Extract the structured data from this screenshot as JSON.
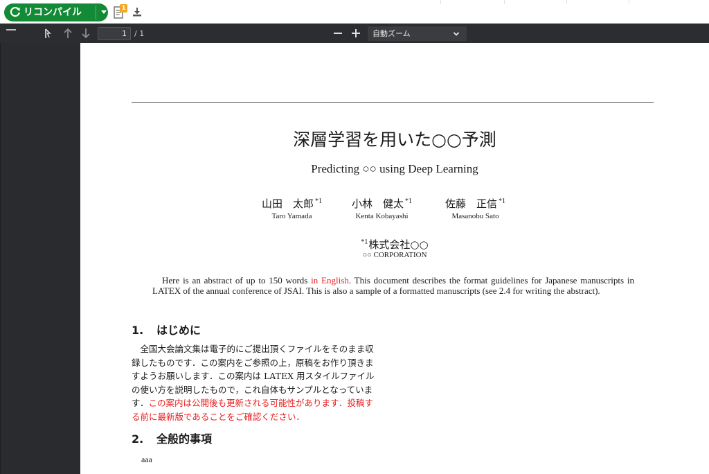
{
  "toolbar": {
    "recompile_label": "リコンパイル",
    "logs_badge_count": "1"
  },
  "pdf_toolbar": {
    "page_current": "1",
    "page_total": "/ 1",
    "zoom_label": "自動ズーム"
  },
  "document": {
    "title_ja": "深層学習を用いた○○予測",
    "title_en": "Predicting ○○ using Deep Learning",
    "authors": [
      {
        "name_ja": "山田　太郎",
        "mark": "*1",
        "name_en": "Taro Yamada"
      },
      {
        "name_ja": "小林　健太",
        "mark": "*1",
        "name_en": "Kenta Kobayashi"
      },
      {
        "name_ja": "佐藤　正信",
        "mark": "*1",
        "name_en": "Masanobu Sato"
      }
    ],
    "affiliation_mark": "*1",
    "affiliation_ja": "株式会社○○",
    "affiliation_en": "○○ CORPORATION",
    "abstract": {
      "part1": "Here is an abstract of up to 150 words ",
      "highlight": "in English",
      "part2": ". This document describes the format guidelines for Japanese manuscripts in LATEX of the annual conference of JSAI. This is also a sample of a formatted manuscripts (see 2.4 for writing the abstract)."
    },
    "sections": [
      {
        "number": "1.",
        "title": "はじめに",
        "lines": [
          "　全国大会論文集は電子的にご提出頂くファイルをそのまま収",
          "録したものです．この案内をご参照の上，原稿をお作り頂きま",
          "すようお願いします．この案内は LATEX 用スタイルファイル",
          "の使い方を説明したもので，これ自体もサンプルとなっていま"
        ],
        "line5_plain": "す．",
        "line5_red": "この案内は公開後も更新される可能性があります．投稿す",
        "line6_red": "る前に最新版であることをご確認ください．"
      },
      {
        "number": "2.",
        "title": "全般的事項",
        "text": "aaa"
      }
    ]
  },
  "colors": {
    "recompile_green": "#138a36",
    "viewer_dark": "#2c2d31",
    "highlight_red": "#e8201f",
    "badge_orange": "#f5a623"
  }
}
